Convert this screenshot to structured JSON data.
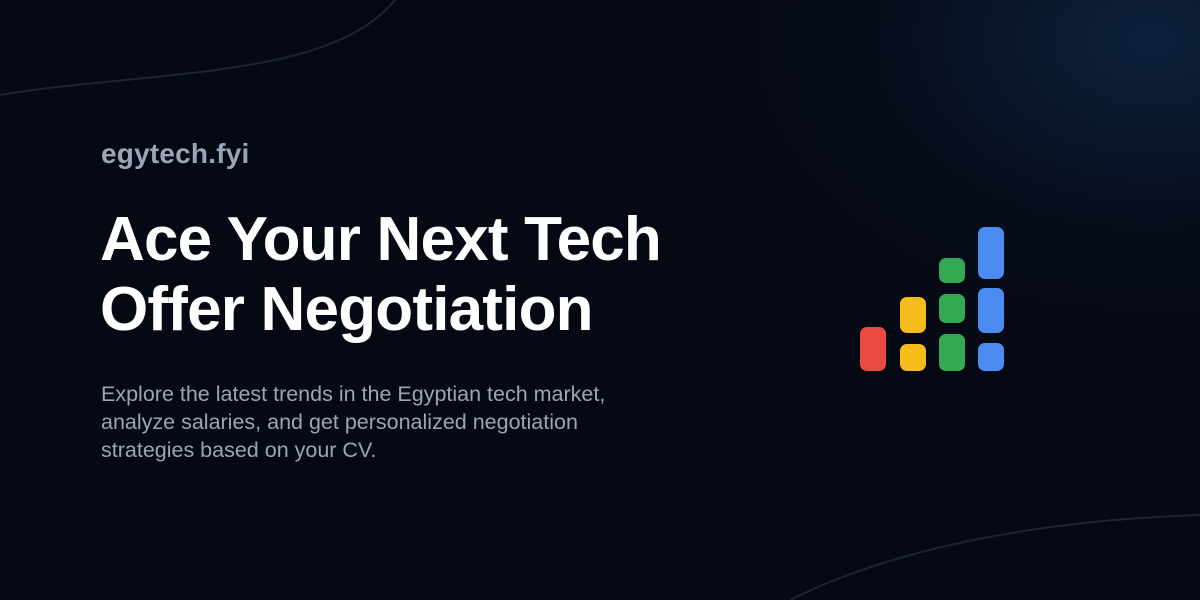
{
  "brand": {
    "name": "egytech.fyi"
  },
  "hero": {
    "headline_lines": [
      "Ace Your Next Tech",
      "Offer Negotiation"
    ],
    "description_lines": [
      "Explore the latest trends in the Egyptian tech market,",
      "analyze salaries, and get personalized negotiation",
      "strategies based on your CV."
    ]
  },
  "logo": {
    "icon": "bar-chart-logo-icon",
    "colors": {
      "red": "#e94b43",
      "yellow": "#f6bc1c",
      "green": "#34a853",
      "blue": "#4b8bf2"
    }
  },
  "theme": {
    "background": "#050914",
    "headline_color": "#ffffff",
    "muted_text": "#9aa6b8"
  }
}
